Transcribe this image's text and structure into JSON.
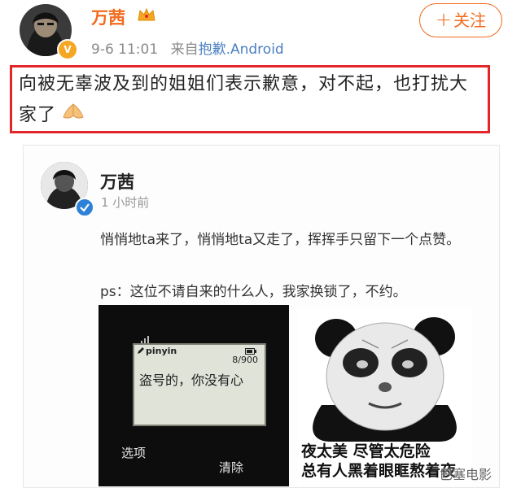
{
  "post": {
    "username": "万茜",
    "time": "9-6 11:01",
    "source_prefix": "来自",
    "source": "抱歉.Android",
    "follow_label": "关注",
    "text": "向被无辜波及到的姐姐们表示歉意，对不起，也打扰大家了"
  },
  "quoted": {
    "username": "万茜",
    "time": "1 小时前",
    "line1": "悄悄地ta来了，悄悄地ta又走了，挥挥手只留下一个点赞。",
    "line2": "ps：这位不请自来的什么人，我家换锁了，不约。",
    "phone": {
      "input_mode": "pinyin",
      "counter": "8/900",
      "message": "盗号的，你没有心",
      "soft_left": "选项",
      "soft_right": "清除"
    },
    "meme_caption_1": "夜太美 尽管太危险",
    "meme_caption_2": "总有人黑着眼眶熬着夜"
  },
  "watermark": "巴塞电影",
  "colors": {
    "brand_orange": "#f26b1d",
    "highlight_red": "#e3262a",
    "link_blue": "#4a7fc1",
    "verify_blue": "#2d82d8"
  }
}
